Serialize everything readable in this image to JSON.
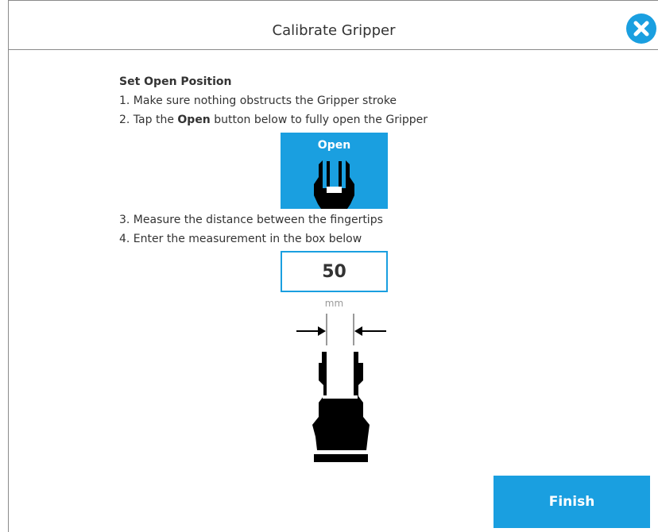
{
  "dialog": {
    "title": "Calibrate Gripper",
    "close_icon": "close-icon",
    "accent_color": "#1a9fe0"
  },
  "instructions": {
    "heading": "Set Open Position",
    "step1": "1. Make sure nothing obstructs the Gripper stroke",
    "step2_prefix": "2. Tap the ",
    "step2_bold": "Open",
    "step2_suffix": " button below to fully open the Gripper",
    "step3": "3. Measure the distance between the fingertips",
    "step4": "4. Enter the measurement in the box below"
  },
  "open_button": {
    "label": "Open",
    "icon": "gripper-open-icon"
  },
  "measurement": {
    "value": "50",
    "unit": "mm"
  },
  "diagram": {
    "icon": "gripper-measurement-diagram"
  },
  "footer": {
    "finish_label": "Finish"
  }
}
